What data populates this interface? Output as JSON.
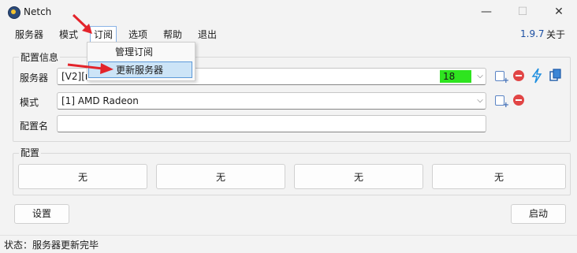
{
  "window": {
    "title": "Netch",
    "minimize": "—",
    "maximize": "☐",
    "close": "✕"
  },
  "menu": {
    "items": [
      "服务器",
      "模式",
      "订阅",
      "选项",
      "帮助",
      "退出"
    ],
    "version": "1.9.7",
    "about": "关于"
  },
  "subscription_menu": {
    "items": [
      "管理订阅",
      "更新服务器"
    ],
    "highlighted_index": 1
  },
  "config": {
    "legend": "配置信息",
    "server_label": "服务器",
    "server_value": "[V2][r",
    "server_latency": "18",
    "mode_label": "模式",
    "mode_value": "[1] AMD Radeon",
    "name_label": "配置名",
    "name_value": ""
  },
  "profiles": {
    "legend": "配置",
    "buttons": [
      "无",
      "无",
      "无",
      "无"
    ]
  },
  "actions": {
    "settings": "设置",
    "start": "启动"
  },
  "status": {
    "text": "状态：服务器更新完毕"
  },
  "colors": {
    "latency_bg": "#2ee41f",
    "version": "#1c4fa3",
    "highlight_bg": "#cce4f7",
    "arrow": "#e3242b"
  },
  "icons": [
    "netch-app-icon",
    "chevron-down-icon",
    "edit-add-icon",
    "delete-icon",
    "lightning-icon",
    "copy-icon",
    "red-arrow-pointer"
  ]
}
